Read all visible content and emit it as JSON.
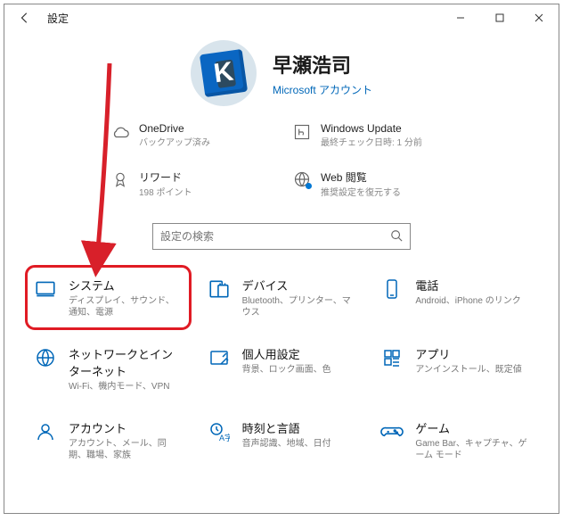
{
  "titlebar": {
    "title": "設定"
  },
  "profile": {
    "avatar_letter": "K",
    "name": "早瀬浩司",
    "ms_account": "Microsoft アカウント"
  },
  "statuses": {
    "onedrive": {
      "title": "OneDrive",
      "sub": "バックアップ済み"
    },
    "update": {
      "title": "Windows Update",
      "sub": "最終チェック日時: 1 分前"
    },
    "rewards": {
      "title": "リワード",
      "sub": "198 ポイント"
    },
    "web": {
      "title": "Web 閲覧",
      "sub": "推奨設定を復元する"
    }
  },
  "search": {
    "placeholder": "設定の検索"
  },
  "tiles": [
    {
      "title": "システム",
      "sub": "ディスプレイ、サウンド、通知、電源"
    },
    {
      "title": "デバイス",
      "sub": "Bluetooth、プリンター、マウス"
    },
    {
      "title": "電話",
      "sub": "Android、iPhone のリンク"
    },
    {
      "title": "ネットワークとインターネット",
      "sub": "Wi-Fi、機内モード、VPN"
    },
    {
      "title": "個人用設定",
      "sub": "背景、ロック画面、色"
    },
    {
      "title": "アプリ",
      "sub": "アンインストール、既定値"
    },
    {
      "title": "アカウント",
      "sub": "アカウント、メール、同期、職場、家族"
    },
    {
      "title": "時刻と言語",
      "sub": "音声認識、地域、日付"
    },
    {
      "title": "ゲーム",
      "sub": "Game Bar、キャプチャ、ゲーム モード"
    }
  ]
}
